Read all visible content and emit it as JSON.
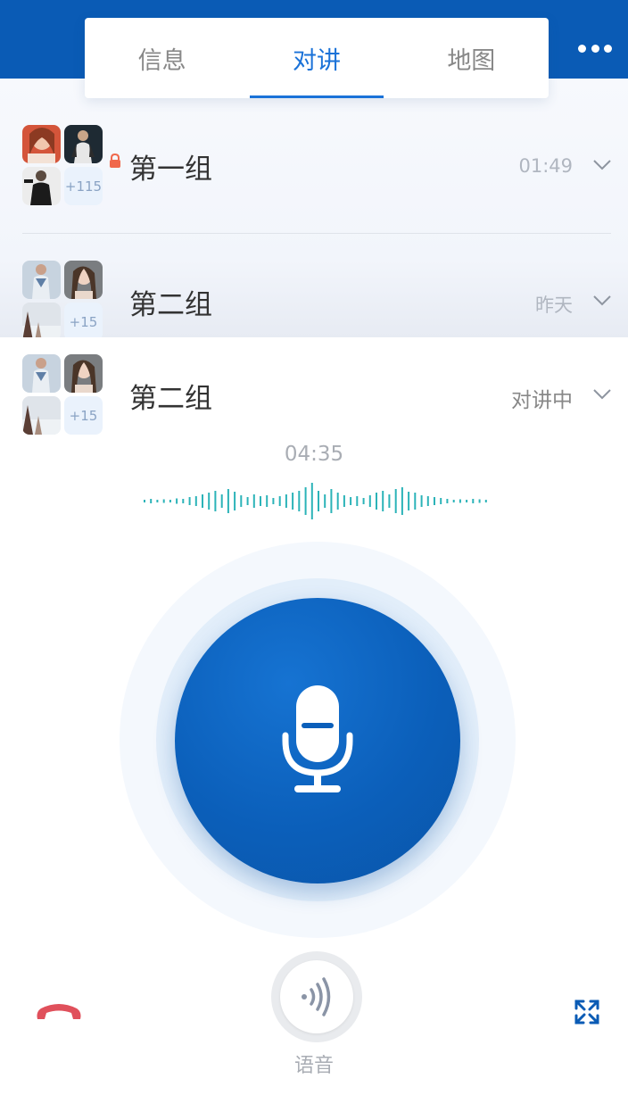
{
  "tabs": [
    {
      "label": "信息",
      "active": false
    },
    {
      "label": "对讲",
      "active": true
    },
    {
      "label": "地图",
      "active": false
    }
  ],
  "groups": [
    {
      "name": "第一组",
      "time": "01:49",
      "extra_count": "+115",
      "locked": true
    },
    {
      "name": "第二组",
      "time": "昨天",
      "extra_count": "+15",
      "locked": false
    }
  ],
  "active_group": {
    "name": "第二组",
    "status": "对讲中",
    "extra_count": "+15"
  },
  "talk": {
    "timer": "04:35"
  },
  "bottom": {
    "voice_label": "语音"
  },
  "colors": {
    "brand": "#0a5bb5",
    "accent": "#1a72d8",
    "hangup": "#e0505b",
    "wave": "#2bb3b8"
  },
  "icons": [
    "more-icon",
    "lock-icon",
    "chevron-down-icon",
    "microphone-icon",
    "hangup-icon",
    "voice-wave-icon",
    "expand-icon"
  ]
}
